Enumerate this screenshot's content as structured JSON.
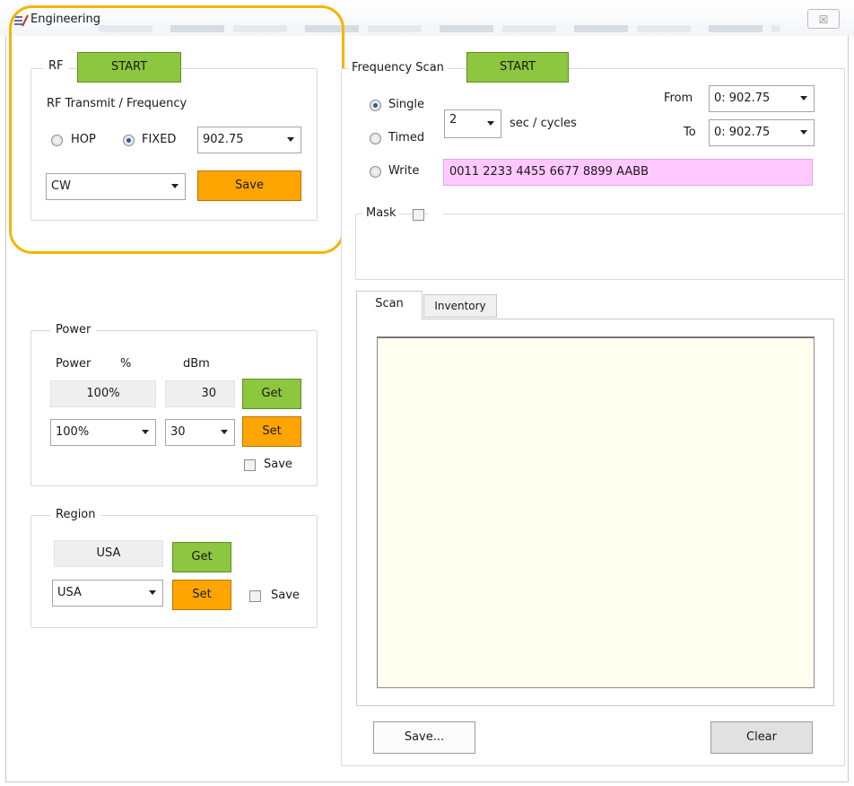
{
  "window": {
    "title": "Engineering",
    "close_symbol": "☒"
  },
  "rf": {
    "group_label": "RF",
    "start_label": "START",
    "subtitle": "RF Transmit / Frequency",
    "hop_label": "HOP",
    "fixed_label": "FIXED",
    "mode_selected": "FIXED",
    "frequency_value": "902.75",
    "modulation_value": "CW",
    "save_label": "Save"
  },
  "power": {
    "group_label": "Power",
    "power_col_label": "Power",
    "percent_col_label": "%",
    "dbm_col_label": "dBm",
    "percent_readout": "100%",
    "dbm_readout": "30",
    "get_label": "Get",
    "percent_select": "100%",
    "dbm_select": "30",
    "set_label": "Set",
    "save_label": "Save",
    "save_checked": false
  },
  "region": {
    "group_label": "Region",
    "readout": "USA",
    "get_label": "Get",
    "select_value": "USA",
    "set_label": "Set",
    "save_label": "Save",
    "save_checked": false
  },
  "freq_scan": {
    "group_label": "Frequency Scan",
    "start_label": "START",
    "single_label": "Single",
    "timed_label": "Timed",
    "write_label": "Write",
    "selected_mode": "Single",
    "cycles_value": "2",
    "cycles_unit": "sec / cycles",
    "from_label": "From",
    "from_value": "0: 902.75",
    "to_label": "To",
    "to_value": "0: 902.75",
    "write_value": "0011 2233 4455 6677 8899 AABB",
    "mask_label": "Mask",
    "mask_checked": false
  },
  "tabs": {
    "items": [
      "Scan",
      "Inventory"
    ],
    "active": "Scan"
  },
  "bottom": {
    "save_label": "Save...",
    "clear_label": "Clear"
  },
  "colors": {
    "green": "#8dc63f",
    "orange": "#ffa500",
    "write_bg": "#ffc8ff",
    "scan_area_bg": "#fffff0",
    "highlight": "#f4b400"
  }
}
